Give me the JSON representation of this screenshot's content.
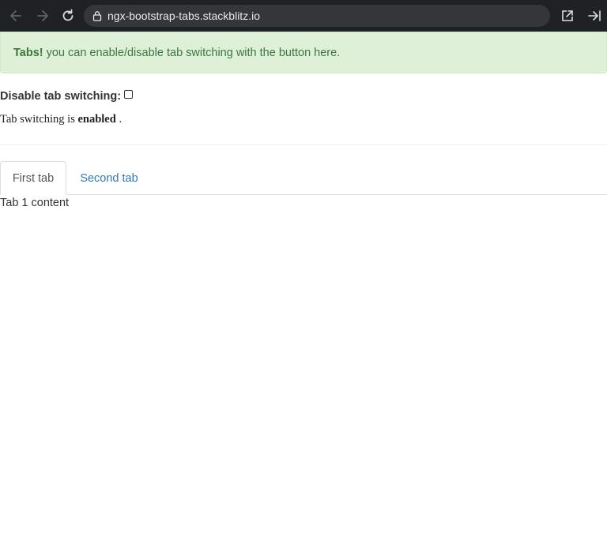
{
  "browser": {
    "url": "ngx-bootstrap-tabs.stackblitz.io",
    "icons": [
      "back-arrow-icon",
      "forward-arrow-icon",
      "reload-icon",
      "lock-icon",
      "open-external-icon",
      "collapse-panel-icon"
    ]
  },
  "alert": {
    "strong": "Tabs!",
    "text": "you can enable/disable tab switching with the button here."
  },
  "toggle": {
    "label": "Disable tab switching:",
    "checked": false
  },
  "status": {
    "prefix": "Tab switching is",
    "state": "enabled",
    "suffix": "."
  },
  "tabs": [
    {
      "label": "First tab",
      "active": true
    },
    {
      "label": "Second tab",
      "active": false
    }
  ],
  "content": {
    "text": "Tab 1 content"
  },
  "colors": {
    "toolbar": "#202124",
    "alert_bg": "#dff0d8",
    "alert_text": "#3c763d",
    "link": "#337ab7"
  }
}
